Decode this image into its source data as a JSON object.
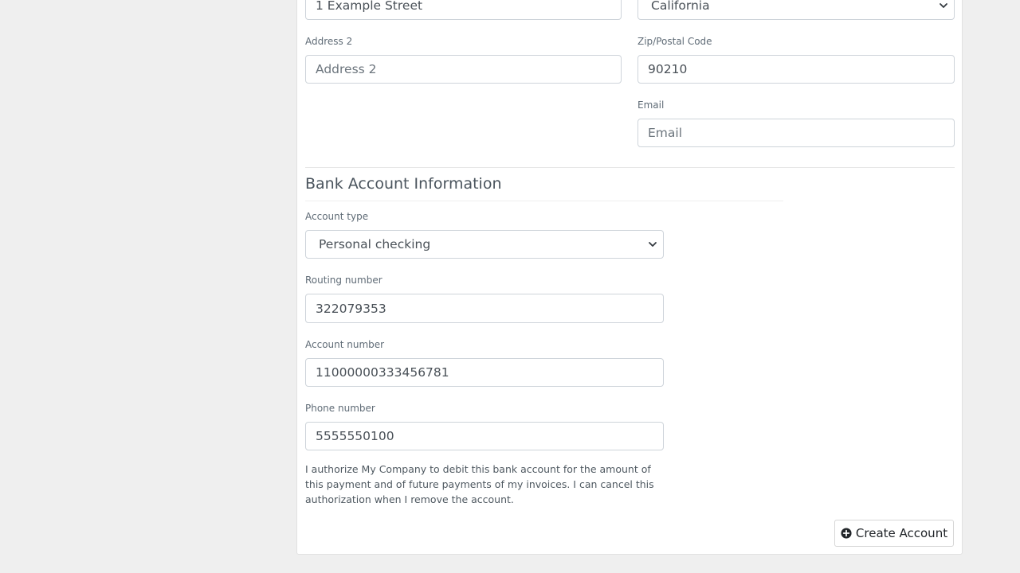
{
  "address": {
    "address1_value": "1 Example Street",
    "address2_label": "Address 2",
    "address2_placeholder": "Address 2",
    "state_value": "California",
    "zip_label": "Zip/Postal Code",
    "zip_value": "90210",
    "email_label": "Email",
    "email_placeholder": "Email"
  },
  "bank": {
    "section_title": "Bank Account Information",
    "account_type_label": "Account type",
    "account_type_value": "Personal checking",
    "routing_label": "Routing number",
    "routing_value": "322079353",
    "account_number_label": "Account number",
    "account_number_value": "11000000333456781",
    "phone_label": "Phone number",
    "phone_value": "5555550100",
    "authorization_text": "I authorize My Company to debit this bank account for the amount of this payment and of future payments of my invoices. I can cancel this authorization when I remove the account."
  },
  "actions": {
    "create_account_label": "Create Account"
  },
  "icons": {
    "select_arrow": "chevron-down-icon",
    "create_button_icon": "plus-circle-icon"
  },
  "colors": {
    "page_background": "#efefef",
    "card_background": "#ffffff",
    "border": "#ced4da",
    "label_text": "#5f6b76"
  }
}
